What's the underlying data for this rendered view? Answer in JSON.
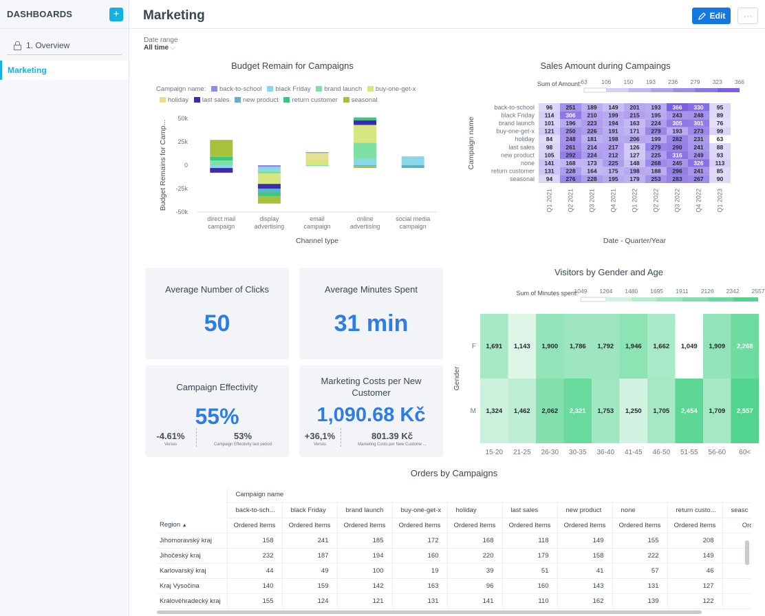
{
  "sidebar": {
    "title": "DASHBOARDS",
    "add_label": "+",
    "items": [
      {
        "label": "1. Overview"
      },
      {
        "label": "Marketing"
      }
    ]
  },
  "header": {
    "title": "Marketing",
    "edit_label": "Edit",
    "more_label": "···"
  },
  "filter": {
    "label": "Date range",
    "value": "All time",
    "caret": "⌵"
  },
  "colors": {
    "primary": "#1478e2",
    "kpi_value": "#2d7de6",
    "heat_purple": "#8a72e6",
    "heat_green": "#4fcf88",
    "sidebar_accent": "#14b2e2"
  },
  "budget_chart": {
    "title": "Budget Remain for Campaigns",
    "legend_label": "Campaign name:",
    "legend": [
      {
        "name": "back-to-school",
        "color": "#8a8ee8"
      },
      {
        "name": "black Friday",
        "color": "#8ad8e6"
      },
      {
        "name": "brand launch",
        "color": "#7fe0a4"
      },
      {
        "name": "buy-one-get-x",
        "color": "#d8e680"
      },
      {
        "name": "holiday",
        "color": "#e6df8f"
      },
      {
        "name": "last sales",
        "color": "#3b2bb0"
      },
      {
        "name": "new product",
        "color": "#5cb2c8"
      },
      {
        "name": "return customer",
        "color": "#3cc57e"
      },
      {
        "name": "seasonal",
        "color": "#a6c23a"
      }
    ],
    "ylabel": "Budget Remains for Camp...",
    "xlabel": "Channel type",
    "yticks": [
      "50k",
      "25k",
      "0",
      "-25k",
      "-50k"
    ],
    "categories": [
      "direct mail campaign",
      "display advertising",
      "email campaign",
      "online advertising",
      "social media campaign"
    ]
  },
  "sales_heatmap": {
    "title": "Sales Amount during Campaings",
    "scale_label": "Sum of Amount:",
    "scale_ticks": [
      "63",
      "106",
      "150",
      "193",
      "236",
      "279",
      "323",
      "366"
    ],
    "ylabel": "Campaign name",
    "xlabel": "Date - Quarter/Year"
  },
  "visitors_heatmap": {
    "title": "Visitors by Gender and Age",
    "scale_label": "Sum of Minutes spent:",
    "scale_ticks": [
      "1049",
      "1264",
      "1480",
      "1695",
      "1911",
      "2126",
      "2342",
      "2557"
    ],
    "ylabel": "Gender"
  },
  "kpis": {
    "clicks": {
      "title": "Average Number of Clicks",
      "value": "50"
    },
    "minutes": {
      "title": "Average Minutes Spent",
      "value": "31 min"
    },
    "effectivity": {
      "title": "Campaign Effectivity",
      "value": "55%",
      "delta": "-4.61%",
      "delta_label": "Versus",
      "prev": "53%",
      "prev_label": "Campaign Effectivity last period"
    },
    "costs": {
      "title": "Marketing Costs per New Customer",
      "value": "1,090.68 Kč",
      "delta": "+36,1%",
      "delta_label": "Versus",
      "prev": "801.39 Kč",
      "prev_label": "Marketing Costs per New Custome ..."
    }
  },
  "orders_table": {
    "title": "Orders by Campaigns",
    "group_header": "Campaign name",
    "row_header": "Region",
    "sort_icon": "▲",
    "columns": [
      "back-to-sch...",
      "black Friday",
      "brand launch",
      "buy-one-get-x",
      "holiday",
      "last sales",
      "new product",
      "none",
      "return custo...",
      "seasc"
    ],
    "metric": "Ordered Items",
    "metric_truncated": "Orde",
    "rows": [
      {
        "region": "Jihomoravský kraj",
        "values": [
          "158",
          "241",
          "185",
          "172",
          "168",
          "118",
          "149",
          "155",
          "208"
        ]
      },
      {
        "region": "Jihočeský kraj",
        "values": [
          "232",
          "187",
          "194",
          "160",
          "220",
          "179",
          "158",
          "222",
          "149"
        ]
      },
      {
        "region": "Karlovarský kraj",
        "values": [
          "44",
          "49",
          "100",
          "19",
          "39",
          "51",
          "41",
          "57",
          "46"
        ]
      },
      {
        "region": "Kraj Vysočina",
        "values": [
          "140",
          "159",
          "142",
          "163",
          "96",
          "160",
          "143",
          "131",
          "127"
        ]
      },
      {
        "region": "Královéhradecký kraj",
        "values": [
          "155",
          "124",
          "121",
          "131",
          "141",
          "110",
          "162",
          "139",
          "122"
        ]
      }
    ]
  },
  "chart_data": [
    {
      "type": "bar",
      "stacked": true,
      "title": "Budget Remain for Campaigns",
      "xlabel": "Channel type",
      "ylabel": "Budget Remains for Camp...",
      "ylim": [
        -50000,
        50000
      ],
      "categories": [
        "direct mail campaign",
        "display advertising",
        "email campaign",
        "online advertising",
        "social media campaign"
      ],
      "series": [
        {
          "name": "back-to-school",
          "values": [
            0,
            -2000,
            0,
            0,
            0
          ]
        },
        {
          "name": "black Friday",
          "values": [
            -3000,
            -4000,
            0,
            7000,
            9500
          ]
        },
        {
          "name": "brand launch",
          "values": [
            5000,
            -3000,
            -1000,
            17000,
            0
          ]
        },
        {
          "name": "buy-one-get-x",
          "values": [
            0,
            -11000,
            6000,
            19000,
            0
          ]
        },
        {
          "name": "holiday",
          "values": [
            0,
            0,
            7000,
            0,
            0
          ]
        },
        {
          "name": "last sales",
          "values": [
            -5000,
            -5000,
            0,
            5000,
            0
          ]
        },
        {
          "name": "new product",
          "values": [
            0,
            -4000,
            1000,
            -1000,
            -3000
          ]
        },
        {
          "name": "return customer",
          "values": [
            4000,
            -4000,
            0,
            3000,
            0
          ]
        },
        {
          "name": "seasonal",
          "values": [
            18000,
            -8000,
            0,
            -2000,
            0
          ]
        }
      ]
    },
    {
      "type": "heatmap",
      "title": "Sales Amount during Campaings",
      "xlabel": "Date - Quarter/Year",
      "ylabel": "Campaign name",
      "x": [
        "Q1 2021",
        "Q2 2021",
        "Q3 2021",
        "Q4 2021",
        "Q1 2022",
        "Q2 2022",
        "Q3 2022",
        "Q4 2022",
        "Q1 2023"
      ],
      "y": [
        "back-to-school",
        "black Friday",
        "brand launch",
        "buy-one-get-x",
        "holiday",
        "last sales",
        "new product",
        "none",
        "return customer",
        "seasonal"
      ],
      "range": [
        63,
        366
      ],
      "values": [
        [
          96,
          251,
          189,
          149,
          201,
          193,
          366,
          330,
          95
        ],
        [
          114,
          306,
          210,
          199,
          215,
          195,
          243,
          248,
          89
        ],
        [
          101,
          196,
          223,
          194,
          163,
          224,
          305,
          301,
          76
        ],
        [
          121,
          250,
          226,
          191,
          171,
          279,
          193,
          273,
          99
        ],
        [
          84,
          248,
          181,
          198,
          206,
          199,
          282,
          231,
          63
        ],
        [
          98,
          261,
          214,
          217,
          126,
          279,
          290,
          241,
          88
        ],
        [
          105,
          292,
          224,
          212,
          127,
          225,
          316,
          249,
          93
        ],
        [
          141,
          168,
          173,
          225,
          148,
          268,
          245,
          326,
          113
        ],
        [
          131,
          228,
          164,
          175,
          198,
          188,
          296,
          241,
          85
        ],
        [
          94,
          276,
          228,
          195,
          179,
          253,
          283,
          267,
          90
        ]
      ]
    },
    {
      "type": "heatmap",
      "title": "Visitors by Gender and Age",
      "ylabel": "Gender",
      "x": [
        "15-20",
        "21-25",
        "26-30",
        "30-35",
        "36-40",
        "41-45",
        "46-50",
        "51-55",
        "56-60",
        "60<"
      ],
      "y": [
        "F",
        "M"
      ],
      "range": [
        1049,
        2557
      ],
      "values": [
        [
          1691,
          1143,
          1900,
          1786,
          1792,
          1946,
          1662,
          1049,
          1909,
          2268
        ],
        [
          1324,
          1462,
          2062,
          2321,
          1753,
          1250,
          1705,
          2454,
          1709,
          2557
        ]
      ],
      "labels": [
        [
          "1,691",
          "1,143",
          "1,900",
          "1,786",
          "1,792",
          "1,946",
          "1,662",
          "1,049",
          "1,909",
          "2,268"
        ],
        [
          "1,324",
          "1,462",
          "2,062",
          "2,321",
          "1,753",
          "1,250",
          "1,705",
          "2,454",
          "1,709",
          "2,557"
        ]
      ]
    }
  ]
}
